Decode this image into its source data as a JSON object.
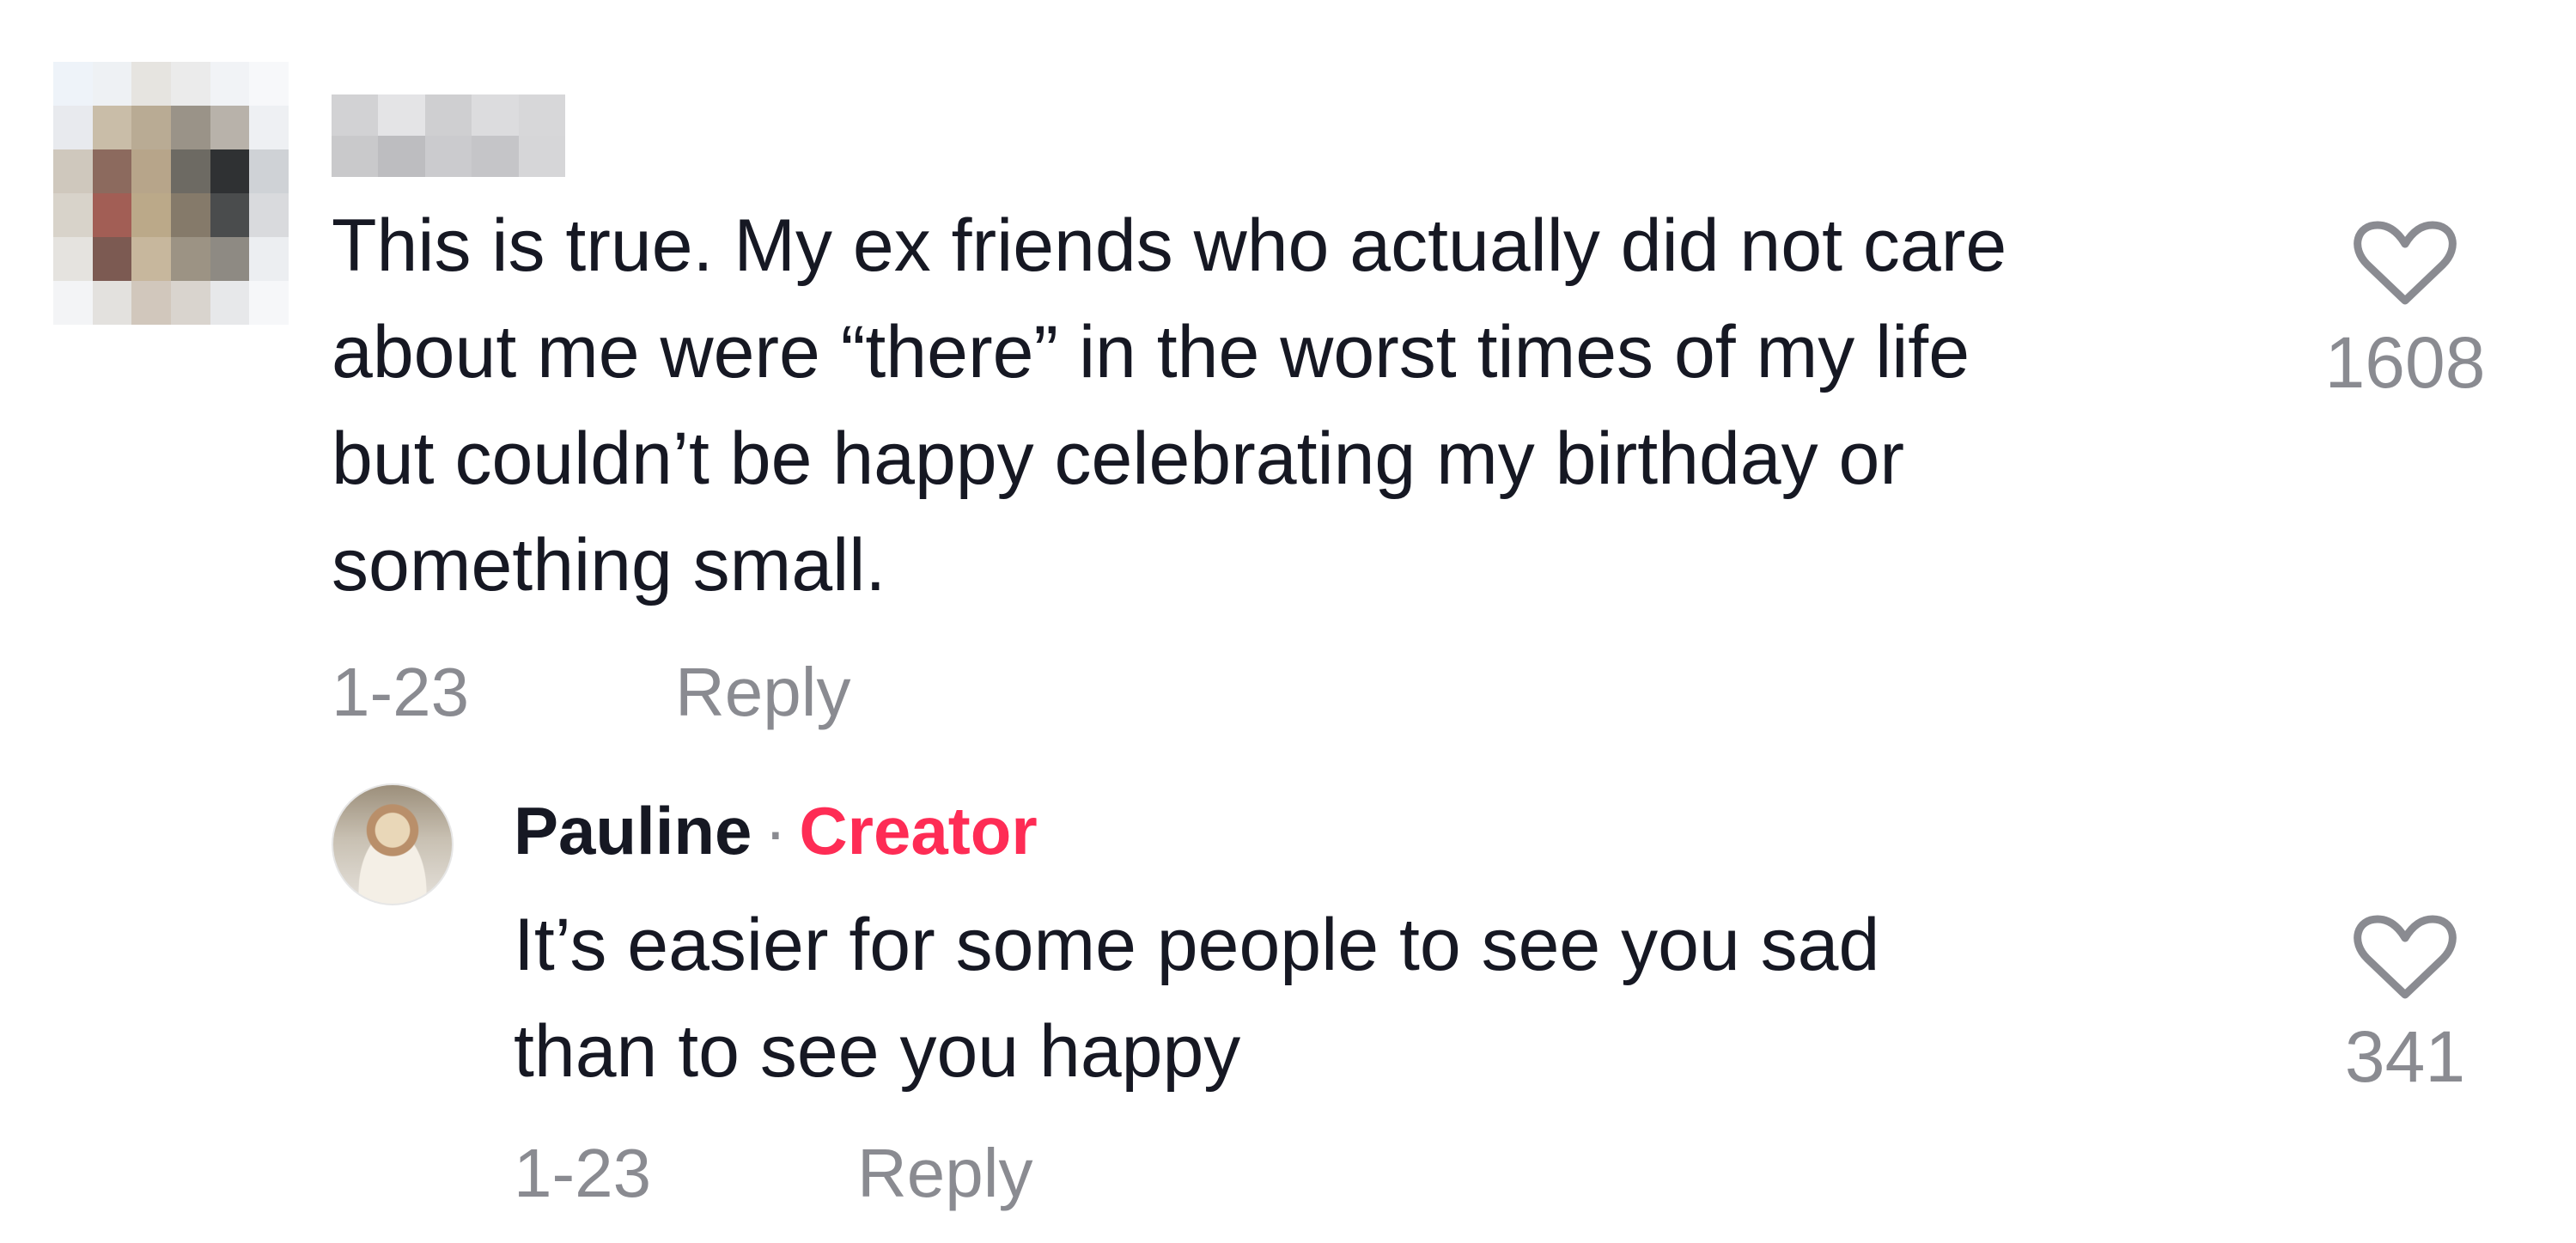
{
  "comments": [
    {
      "text": "This is true. My ex friends who actually did not care\nabout me were “there” in the worst times of my life\nbut couldn’t be happy celebrating my birthday or\nsomething small.",
      "date": "1-23",
      "reply_label": "Reply",
      "likes": "1608",
      "avatar_icon": "pixelated-avatar",
      "username_icon": "pixelated-username"
    },
    {
      "author": "Pauline",
      "separator": "·",
      "badge": "Creator",
      "text": "It’s easier for some people to see you sad\nthan to see you happy",
      "date": "1-23",
      "reply_label": "Reply",
      "likes": "341"
    }
  ],
  "colors": {
    "text": "#161823",
    "secondary": "#8a8b91",
    "creator_badge": "#fe2c55"
  },
  "icons": {
    "like": "heart-outline-icon"
  }
}
